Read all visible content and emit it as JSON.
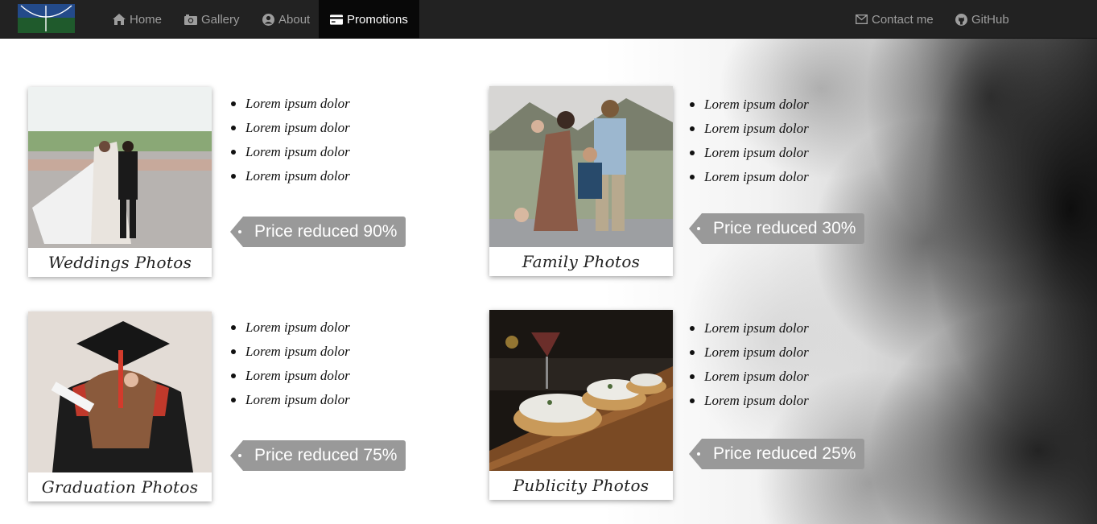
{
  "nav": {
    "left": [
      {
        "label": "Home",
        "icon": "home-icon"
      },
      {
        "label": "Gallery",
        "icon": "camera-icon"
      },
      {
        "label": "About",
        "icon": "user-circle-icon"
      },
      {
        "label": "Promotions",
        "icon": "credit-card-icon",
        "active": true
      }
    ],
    "right": [
      {
        "label": "Contact me",
        "icon": "envelope-icon"
      },
      {
        "label": "GitHub",
        "icon": "github-icon"
      }
    ]
  },
  "colors": {
    "navbar": "#222222",
    "active_tab": "#080808",
    "nav_text": "#9d9d9d",
    "tag": "#999999"
  },
  "promotions": [
    {
      "caption": "Weddings Photos",
      "items": [
        "Lorem ipsum dolor",
        "Lorem ipsum dolor",
        "Lorem ipsum dolor",
        "Lorem ipsum dolor"
      ],
      "price": "Price reduced 90%"
    },
    {
      "caption": "Family Photos",
      "items": [
        "Lorem ipsum dolor",
        "Lorem ipsum dolor",
        "Lorem ipsum dolor",
        "Lorem ipsum dolor"
      ],
      "price": "Price reduced 30%"
    },
    {
      "caption": "Graduation Photos",
      "items": [
        "Lorem ipsum dolor",
        "Lorem ipsum dolor",
        "Lorem ipsum dolor",
        "Lorem ipsum dolor"
      ],
      "price": "Price reduced 75%"
    },
    {
      "caption": "Publicity Photos",
      "items": [
        "Lorem ipsum dolor",
        "Lorem ipsum dolor",
        "Lorem ipsum dolor",
        "Lorem ipsum dolor"
      ],
      "price": "Price reduced 25%"
    }
  ]
}
